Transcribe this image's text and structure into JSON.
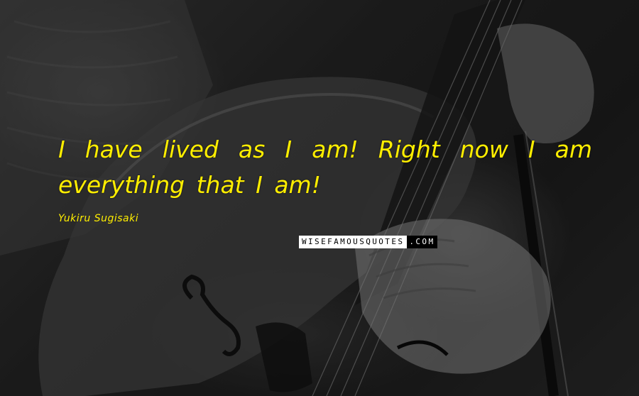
{
  "quote": {
    "text": "I have lived as I am! Right now I am everything that I am!",
    "color": "#ffee00"
  },
  "author": {
    "name": "Yukiru Sugisaki"
  },
  "watermark": {
    "main": "WISEFAMOUSQUOTES",
    "suffix": ".COM"
  }
}
